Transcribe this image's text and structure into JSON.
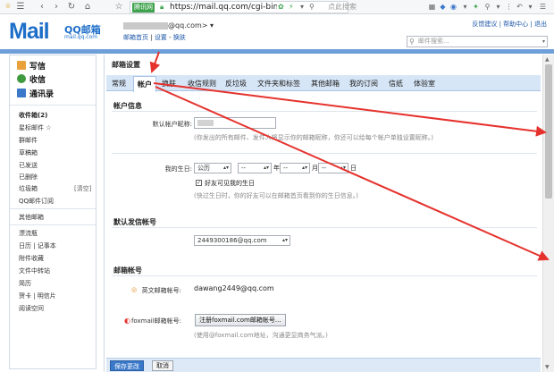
{
  "browser": {
    "secure_badge": "腾讯网",
    "url": "https://mail.qq.com/cgi-bin/fr",
    "search_placeholder": "点此搜索"
  },
  "header": {
    "logo_text": "Mail",
    "brand": "QQ邮箱",
    "brand_sub": "mail.qq.com",
    "account_suffix": "@qq.com> ▾",
    "links": [
      "邮箱首页",
      "设置",
      "换肤"
    ],
    "top_links": "反馈建议 | 帮助中心 | 退出",
    "search_placeholder": "邮件搜索..."
  },
  "sidebar": {
    "compose": "写信",
    "inbox_main": "收信",
    "contacts": "通讯录",
    "items": [
      {
        "label": "收件箱(2)",
        "bold": true
      },
      {
        "label": "星标邮件 ☆"
      },
      {
        "label": "群邮件"
      },
      {
        "label": "草稿箱"
      },
      {
        "label": "已发送"
      },
      {
        "label": "已删除"
      },
      {
        "label": "垃圾箱"
      },
      {
        "label": "QQ邮件订阅"
      }
    ],
    "trash_clear": "[清空]",
    "other_header": "其他邮箱",
    "others": [
      "漂流瓶",
      "日历 | 记事本",
      "附件收藏",
      "文件中转站",
      "简历",
      "贺卡 | 明信片",
      "阅读空间"
    ]
  },
  "settings": {
    "title": "邮箱设置",
    "tabs": [
      "常规",
      "帐户",
      "换肤",
      "收信规则",
      "反垃圾",
      "文件夹和标签",
      "其他邮箱",
      "我的订阅",
      "信纸",
      "体验室"
    ],
    "active_tab": "帐户",
    "account_info": {
      "header": "帐户信息",
      "nickname_label": "默认帐户昵称:",
      "nickname_hint": "(你发出的所有邮件、发件人将显示你的邮箱昵称，你还可以给每个帐户单独设置昵称。)",
      "birthday_label": "我的生日:",
      "calendar_value": "公历",
      "year_placeholder": "--",
      "year_suffix": "年",
      "month_value": "--",
      "month_suffix": "月",
      "day_value": "--",
      "day_suffix": "日",
      "birthday_check": "好友可见我的生日",
      "birthday_hint": "(快过生日时，你的好友可以在邮箱首页看到你的生日信息。)"
    },
    "default_sender": {
      "header": "默认发信帐号",
      "value": "2449300186@qq.com"
    },
    "mail_accounts": {
      "header": "邮箱帐号",
      "english_label": "英文邮箱帐号:",
      "english_value": "dawang2449@qq.com",
      "foxmail_label": "foxmail邮箱帐号:",
      "foxmail_button": "注册foxmail.com邮箱帐号...",
      "foxmail_hint": "(使用@foxmail.com地址，沟通更显商务气派。)"
    },
    "save_button": "保存更改",
    "cancel_button": "取消"
  },
  "colors": {
    "accent": "#1e6fc8",
    "tabbar": "#d7e6f7",
    "annotation": "#e5322d"
  }
}
